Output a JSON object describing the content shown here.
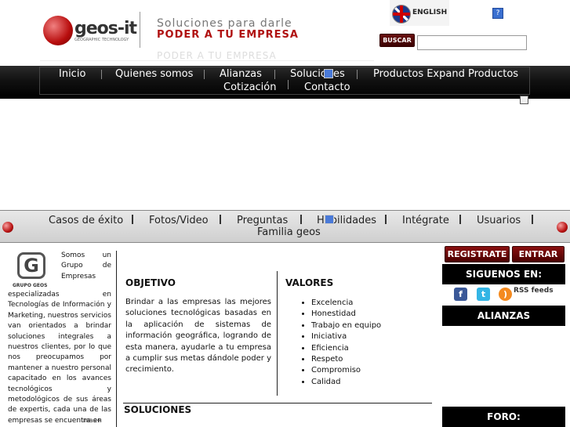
{
  "header": {
    "logo_text": "geos-it",
    "logo_sub": "GEOGRAPHIC TECHNOLOGY",
    "slogan_line1": "Soluciones para darle",
    "slogan_line2": "PODER A TU EMPRESA",
    "language_label": "ENGLISH",
    "help_label": "?",
    "search_button": "BUSCAR",
    "search_value": ""
  },
  "main_nav": {
    "items": [
      "Inicio",
      "Quienes somos",
      "Alianzas",
      "Soluciones",
      "Productos Expand Productos",
      "Cotización",
      "Contacto"
    ]
  },
  "sub_nav": {
    "items": [
      "Casos de éxito",
      "Fotos/Video",
      "Preguntas",
      "Habilidades",
      "Intégrate",
      "Usuarios",
      "Familia geos"
    ]
  },
  "about": {
    "logo_caption": "GRUPO GEOS",
    "logo_letter": "G",
    "text": "Somos un Grupo de Empresas especializadas en Tecnologías de Información y Marketing, nuestros servicios van orientados a brindar soluciones integrales a nuestros clientes, por lo que nos preocupamos por mantener a nuestro personal capacitado en los avances tecnológicos y metodológicos de sus áreas de expertis, cada una de las empresas se encuentra en",
    "more_label": "mas+"
  },
  "objetivo": {
    "title": "OBJETIVO",
    "text": "Brindar a las empresas las mejores soluciones tecnológicas basadas en la aplicación de sistemas de información geográfica, logrando de esta manera, ayudarle a tu empresa a cumplir sus metas dándole poder y crecimiento."
  },
  "valores": {
    "title": "VALORES",
    "items": [
      "Excelencia",
      "Honestidad",
      "Trabajo en equipo",
      "Iniciativa",
      "Eficiencia",
      "Respeto",
      "Compromiso",
      "Calidad"
    ]
  },
  "soluciones": {
    "title": "SOLUCIONES"
  },
  "sidebar": {
    "register_button": "REGISTRATE",
    "login_button": "ENTRAR",
    "follow_title": "SIGUENOS EN:",
    "rss_label": "RSS feeds",
    "alliances_title": "ALIANZAS",
    "forum_title": "FORO:"
  },
  "colors": {
    "brand_red": "#b01010",
    "nav_black": "#000000"
  }
}
